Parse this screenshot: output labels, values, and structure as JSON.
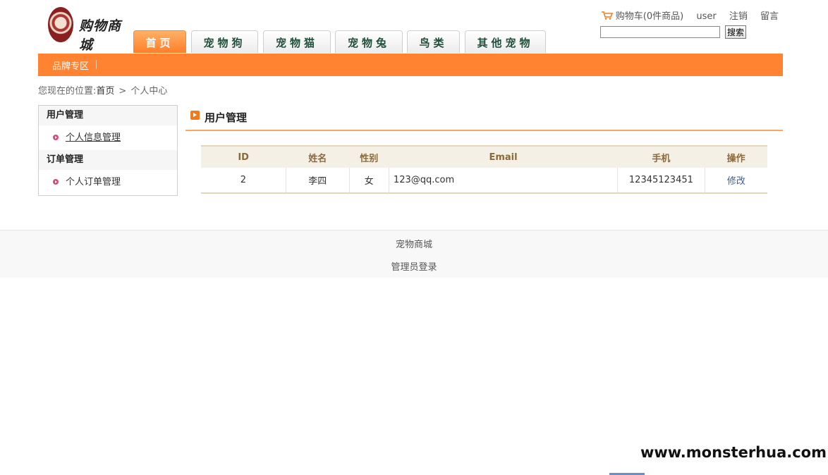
{
  "logo": {
    "text": "购物商城"
  },
  "nav": {
    "tabs": [
      {
        "label": "首页",
        "active": true
      },
      {
        "label": "宠物狗"
      },
      {
        "label": "宠物猫"
      },
      {
        "label": "宠物兔"
      },
      {
        "label": "鸟类"
      },
      {
        "label": "其他宠物"
      }
    ]
  },
  "topbar": {
    "cart": "购物车(0件商品)",
    "user": "user",
    "logout": "注销",
    "message": "留言",
    "search_button": "搜索",
    "search_value": ""
  },
  "subnav": {
    "brand_zone": "品牌专区"
  },
  "breadcrumb": {
    "prefix": "您现在的位置:",
    "home": "首页",
    "sep": ">",
    "current": "个人中心"
  },
  "sidebar": {
    "sections": [
      {
        "title": "用户管理",
        "items": [
          "个人信息管理"
        ]
      },
      {
        "title": "订单管理",
        "items": [
          "个人订单管理"
        ]
      }
    ]
  },
  "content": {
    "title": "用户管理",
    "table": {
      "headers": [
        "ID",
        "姓名",
        "性别",
        "Email",
        "手机",
        "操作"
      ],
      "rows": [
        [
          "2",
          "李四",
          "女",
          "123@qq.com",
          "12345123451",
          "修改"
        ]
      ]
    }
  },
  "footer": {
    "line1": "宠物商城",
    "line2": "管理员登录"
  },
  "watermark": "www.monsterhua.com",
  "colors": {
    "accent": "#ff8330",
    "header_text": "#8a6a3a",
    "link": "#3a5f9a"
  }
}
